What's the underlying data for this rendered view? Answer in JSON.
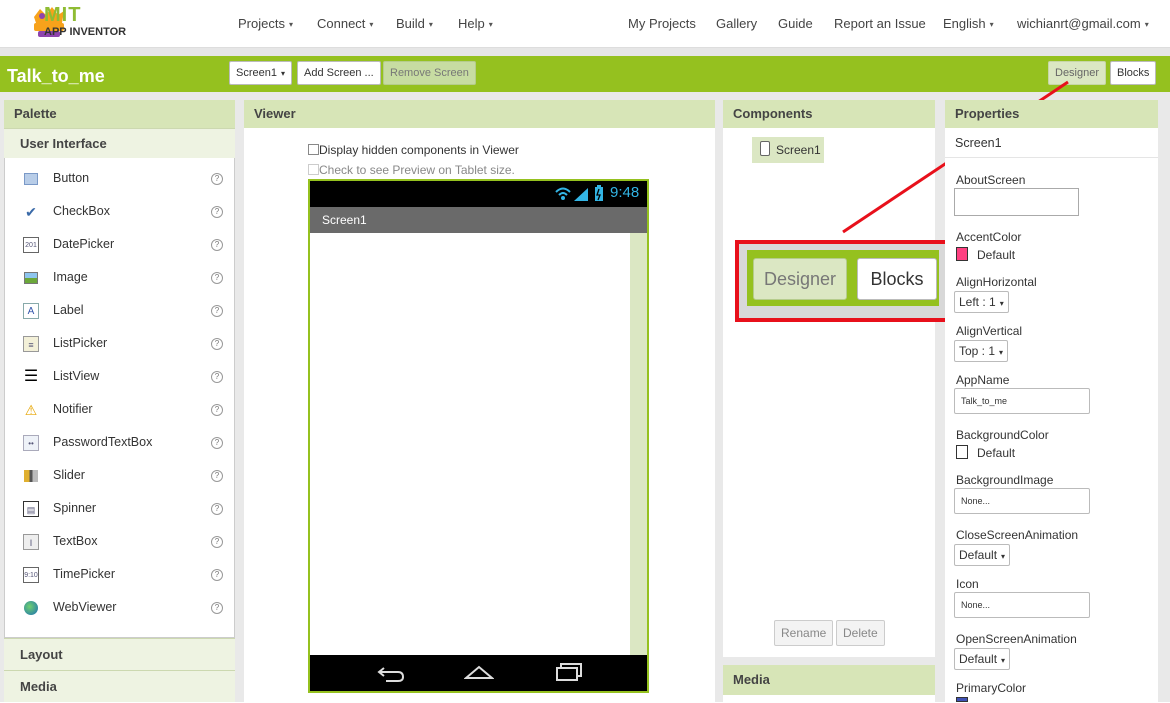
{
  "topbar": {
    "logo_mit": "MIT",
    "logo_sub": "APP INVENTOR",
    "menus": [
      "Projects",
      "Connect",
      "Build",
      "Help"
    ],
    "links": [
      "My Projects",
      "Gallery",
      "Guide",
      "Report an Issue"
    ],
    "language": "English",
    "user": "wichianrt@gmail.com"
  },
  "project": {
    "title": "Talk_to_me",
    "screen_select": "Screen1",
    "add_screen": "Add Screen ...",
    "remove_screen": "Remove Screen",
    "designer": "Designer",
    "blocks": "Blocks"
  },
  "palette": {
    "header": "Palette",
    "category": "User Interface",
    "items": [
      {
        "label": "Button",
        "icon": "button-icon"
      },
      {
        "label": "CheckBox",
        "icon": "checkbox-icon"
      },
      {
        "label": "DatePicker",
        "icon": "datepicker-icon"
      },
      {
        "label": "Image",
        "icon": "image-icon"
      },
      {
        "label": "Label",
        "icon": "label-icon"
      },
      {
        "label": "ListPicker",
        "icon": "listpicker-icon"
      },
      {
        "label": "ListView",
        "icon": "listview-icon"
      },
      {
        "label": "Notifier",
        "icon": "notifier-icon"
      },
      {
        "label": "PasswordTextBox",
        "icon": "password-icon"
      },
      {
        "label": "Slider",
        "icon": "slider-icon"
      },
      {
        "label": "Spinner",
        "icon": "spinner-icon"
      },
      {
        "label": "TextBox",
        "icon": "textbox-icon"
      },
      {
        "label": "TimePicker",
        "icon": "timepicker-icon"
      },
      {
        "label": "WebViewer",
        "icon": "webviewer-icon"
      }
    ],
    "help_glyph": "?",
    "more_categories": [
      "Layout",
      "Media"
    ]
  },
  "viewer": {
    "header": "Viewer",
    "hidden_cb": "Display hidden components in Viewer",
    "tablet_cb": "Check to see Preview on Tablet size.",
    "time": "9:48",
    "screen_title": "Screen1"
  },
  "components": {
    "header": "Components",
    "tree_item": "Screen1",
    "rename": "Rename",
    "delete": "Delete",
    "media_header": "Media",
    "zoom_designer": "Designer",
    "zoom_blocks": "Blocks"
  },
  "properties": {
    "header": "Properties",
    "component": "Screen1",
    "about_screen": "AboutScreen",
    "accent_color": "AccentColor",
    "accent_value": "Default",
    "align_h": "AlignHorizontal",
    "align_h_value": "Left : 1",
    "align_v": "AlignVertical",
    "align_v_value": "Top : 1",
    "app_name": "AppName",
    "app_name_value": "Talk_to_me",
    "bg_color": "BackgroundColor",
    "bg_color_value": "Default",
    "bg_image": "BackgroundImage",
    "bg_image_value": "None...",
    "close_anim": "CloseScreenAnimation",
    "close_anim_value": "Default",
    "icon": "Icon",
    "icon_value": "None...",
    "open_anim": "OpenScreenAnimation",
    "open_anim_value": "Default",
    "primary_color": "PrimaryColor"
  },
  "colors": {
    "brand_green": "#95c11f",
    "accent_pink": "#ff4081",
    "annotation_red": "#e8101b"
  }
}
